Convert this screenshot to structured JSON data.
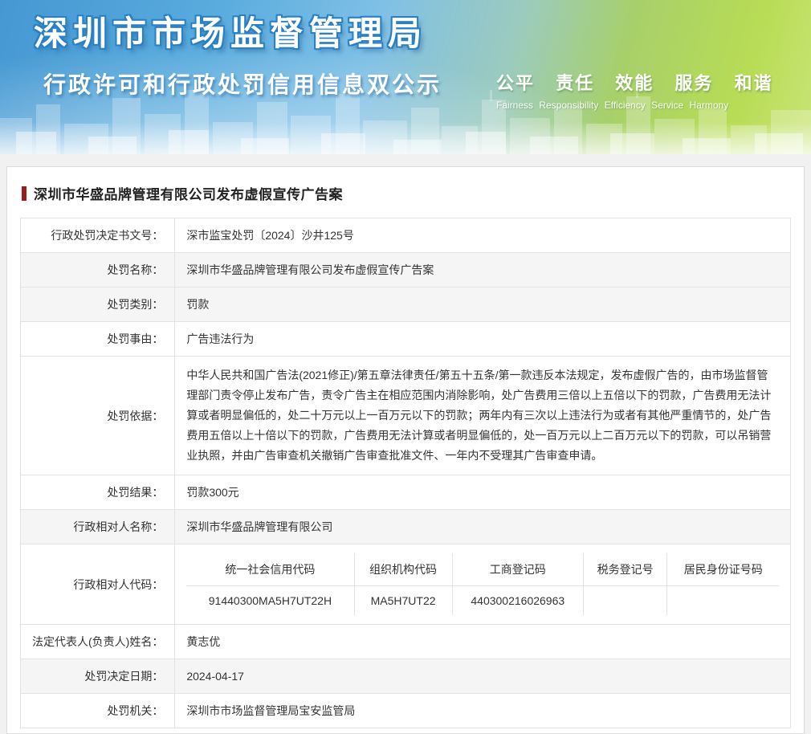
{
  "header": {
    "agency_title": "深圳市市场监督管理局",
    "banner_subtitle": "行政许可和行政处罚信用信息双公示",
    "slogan_cn": "公平 责任 效能 服务 和谐",
    "slogan_en": "Fairness Responsibility Efficiency Service Harmony"
  },
  "page": {
    "title": "深圳市华盛品牌管理有限公司发布虚假宣传广告案",
    "accent_color": "#9e1b1b"
  },
  "record": {
    "rows": [
      {
        "label": "行政处罚决定书文号：",
        "value": "深市监宝处罚〔2024〕沙井125号"
      },
      {
        "label": "处罚名称：",
        "value": "深圳市华盛品牌管理有限公司发布虚假宣传广告案"
      },
      {
        "label": "处罚类别：",
        "value": "罚款"
      },
      {
        "label": "处罚事由：",
        "value": "广告违法行为"
      },
      {
        "label": "处罚依据：",
        "value": "中华人民共和国广告法(2021修正)/第五章法律责任/第五十五条/第一款违反本法规定，发布虚假广告的，由市场监督管理部门责令停止发布广告，责令广告主在相应范围内消除影响，处广告费用三倍以上五倍以下的罚款，广告费用无法计算或者明显偏低的，处二十万元以上一百万元以下的罚款；两年内有三次以上违法行为或者有其他严重情节的，处广告费用五倍以上十倍以下的罚款，广告费用无法计算或者明显偏低的，处一百万元以上二百万元以下的罚款，可以吊销营业执照，并由广告审查机关撤销广告审查批准文件、一年内不受理其广告审查申请。"
      },
      {
        "label": "处罚结果：",
        "value": "罚款300元"
      },
      {
        "label": "行政相对人名称：",
        "value": "深圳市华盛品牌管理有限公司"
      },
      {
        "label": "法定代表人(负责人)姓名：",
        "value": "黄志优"
      },
      {
        "label": "处罚决定日期：",
        "value": "2024-04-17"
      },
      {
        "label": "处罚机关：",
        "value": "深圳市市场监督管理局宝安监管局"
      }
    ],
    "code_section": {
      "label": "行政相对人代码：",
      "columns": [
        "统一社会信用代码",
        "组织机构代码",
        "工商登记码",
        "税务登记号",
        "居民身份证号码"
      ],
      "values": [
        "91440300MA5H7UT22H",
        "MA5H7UT22",
        "440300216026963",
        "",
        ""
      ]
    }
  }
}
